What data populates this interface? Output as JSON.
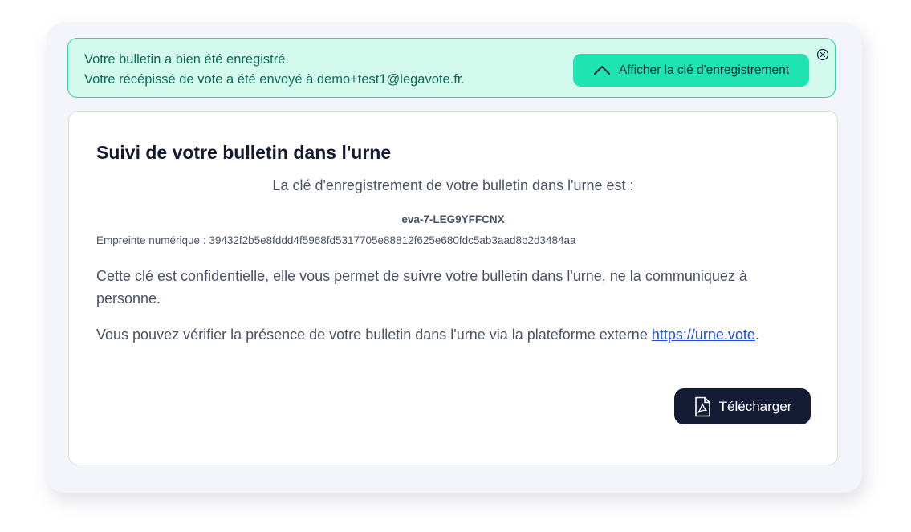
{
  "alert": {
    "line1": "Votre bulletin a bien été enregistré.",
    "line2": "Votre récépissé de vote a été envoyé à demo+test1@legavote.fr.",
    "show_key_label": "Afficher la clé d'enregistrement",
    "show_key_icon": "chevron-up-icon",
    "close_icon": "close-circle-icon"
  },
  "card": {
    "title": "Suivi de votre bulletin dans l'urne",
    "key_intro": "La clé d'enregistrement de votre bulletin dans l'urne est :",
    "key_value": "eva-7-LEG9YFFCNX",
    "fingerprint_label": "Empreinte numérique : ",
    "fingerprint_value": "39432f2b5e8fddd4f5968fd5317705e88812f625e680fdc5ab3aad8b2d3484aa",
    "confidential_text": "Cette clé est confidentielle, elle vous permet de suivre votre bulletin dans l'urne, ne la communiquez à personne.",
    "verify_text": "Vous pouvez vérifier la présence de votre bulletin dans l'urne via la plateforme externe ",
    "verify_link": "https://urne.vote",
    "verify_end": ".",
    "download_label": "Télécharger",
    "download_icon": "pdf-file-icon"
  },
  "colors": {
    "alert_bg": "#d3faec",
    "alert_border": "#2fd3a8",
    "accent_button": "#1fe3b0",
    "dark_button": "#141b35",
    "link": "#1f4ed8"
  }
}
